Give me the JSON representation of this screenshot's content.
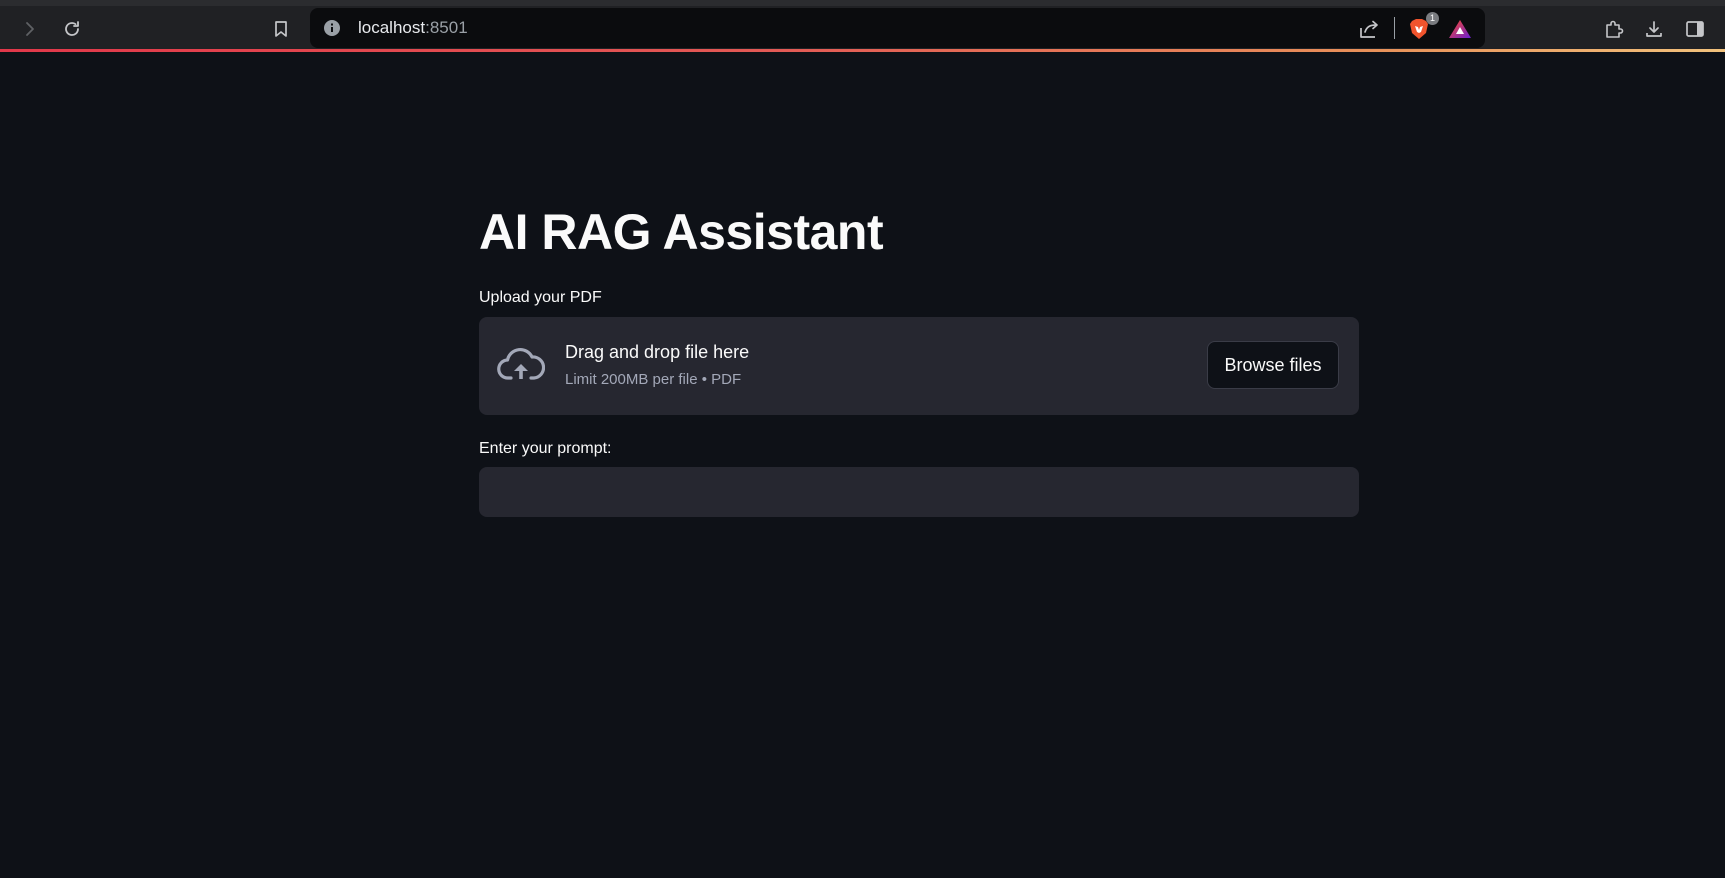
{
  "browser": {
    "url_host": "localhost",
    "url_port": ":8501",
    "brave_badge_count": "1",
    "icons": {
      "forward": "chevron-right-icon",
      "reload": "reload-icon",
      "bookmark": "bookmark-icon",
      "site_info": "info-icon",
      "share": "share-icon",
      "brave_shields": "brave-lion-icon",
      "brave_rewards": "triangle-rewards-icon",
      "extensions": "puzzle-icon",
      "downloads": "download-icon",
      "sidebar": "sidebar-icon"
    },
    "accent_gradient": [
      "#e1384a",
      "#e8925a",
      "#f1c27d"
    ]
  },
  "app": {
    "title": "AI RAG Assistant",
    "uploader": {
      "label": "Upload your PDF",
      "drop_title": "Drag and drop file here",
      "drop_subtitle": "Limit 200MB per file • PDF",
      "browse_label": "Browse files",
      "icon": "cloud-upload-icon"
    },
    "prompt": {
      "label": "Enter your prompt:",
      "value": "",
      "placeholder": ""
    },
    "colors": {
      "background": "#0e1117",
      "surface": "#262730",
      "text": "#fafafa",
      "muted": "#a3a8b8"
    }
  }
}
